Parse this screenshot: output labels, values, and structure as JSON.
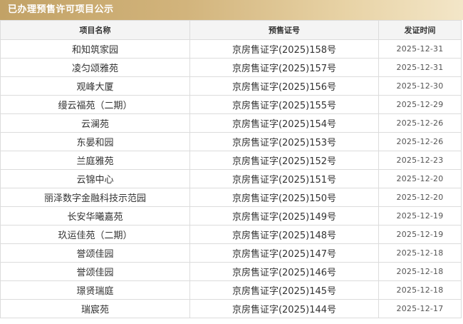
{
  "panel": {
    "title": "已办理预售许可项目公示"
  },
  "table": {
    "headers": [
      "项目名称",
      "预售证号",
      "发证时间"
    ],
    "rows": [
      {
        "name": "和知筑家园",
        "permit": "京房售证字(2025)158号",
        "date": "2025-12-31"
      },
      {
        "name": "凌匀颂雅苑",
        "permit": "京房售证字(2025)157号",
        "date": "2025-12-31"
      },
      {
        "name": "观峰大厦",
        "permit": "京房售证字(2025)156号",
        "date": "2025-12-30"
      },
      {
        "name": "缦云福苑（二期）",
        "permit": "京房售证字(2025)155号",
        "date": "2025-12-29"
      },
      {
        "name": "云澜苑",
        "permit": "京房售证字(2025)154号",
        "date": "2025-12-26"
      },
      {
        "name": "东晏和园",
        "permit": "京房售证字(2025)153号",
        "date": "2025-12-26"
      },
      {
        "name": "兰庭雅苑",
        "permit": "京房售证字(2025)152号",
        "date": "2025-12-23"
      },
      {
        "name": "云锦中心",
        "permit": "京房售证字(2025)151号",
        "date": "2025-12-20"
      },
      {
        "name": "丽泽数字金融科技示范园",
        "permit": "京房售证字(2025)150号",
        "date": "2025-12-20"
      },
      {
        "name": "长安华曦嘉苑",
        "permit": "京房售证字(2025)149号",
        "date": "2025-12-19"
      },
      {
        "name": "玖运佳苑（二期）",
        "permit": "京房售证字(2025)148号",
        "date": "2025-12-19"
      },
      {
        "name": "誉颂佳园",
        "permit": "京房售证字(2025)147号",
        "date": "2025-12-18"
      },
      {
        "name": "誉颂佳园",
        "permit": "京房售证字(2025)146号",
        "date": "2025-12-18"
      },
      {
        "name": "璟贤瑞庭",
        "permit": "京房售证字(2025)145号",
        "date": "2025-12-18"
      },
      {
        "name": "瑞宸苑",
        "permit": "京房售证字(2025)144号",
        "date": "2025-12-17"
      }
    ]
  }
}
